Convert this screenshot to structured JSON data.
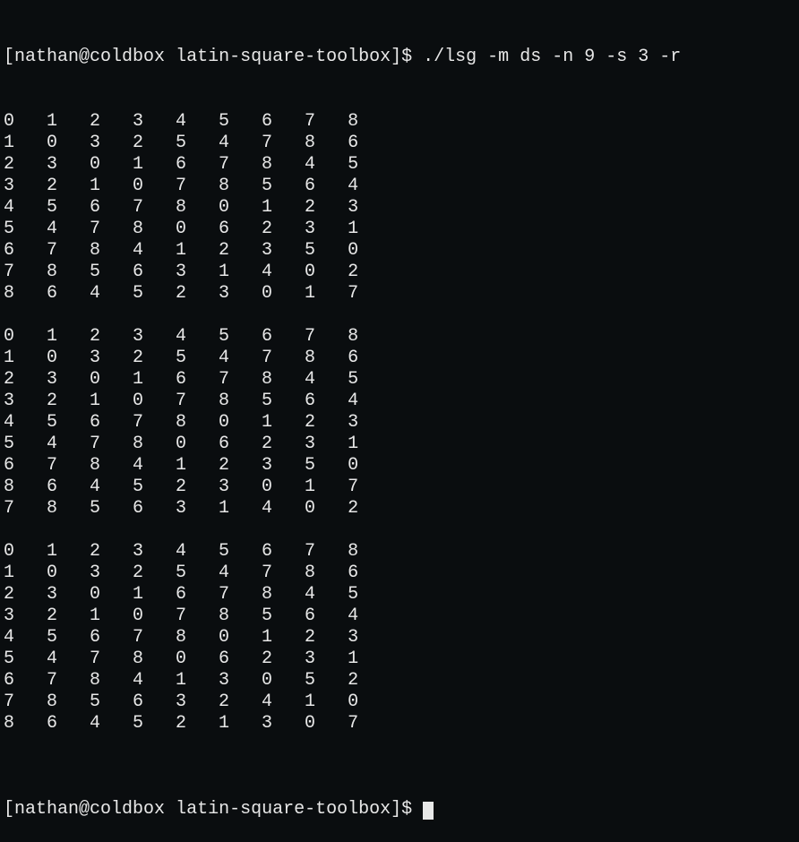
{
  "prompt1": {
    "user": "nathan",
    "host": "coldbox",
    "dir": "latin-square-toolbox",
    "symbol": "$",
    "command": "./lsg -m ds -n 9 -s 3 -r"
  },
  "prompt2": {
    "user": "nathan",
    "host": "coldbox",
    "dir": "latin-square-toolbox",
    "symbol": "$"
  },
  "squares": [
    [
      [
        0,
        1,
        2,
        3,
        4,
        5,
        6,
        7,
        8
      ],
      [
        1,
        0,
        3,
        2,
        5,
        4,
        7,
        8,
        6
      ],
      [
        2,
        3,
        0,
        1,
        6,
        7,
        8,
        4,
        5
      ],
      [
        3,
        2,
        1,
        0,
        7,
        8,
        5,
        6,
        4
      ],
      [
        4,
        5,
        6,
        7,
        8,
        0,
        1,
        2,
        3
      ],
      [
        5,
        4,
        7,
        8,
        0,
        6,
        2,
        3,
        1
      ],
      [
        6,
        7,
        8,
        4,
        1,
        2,
        3,
        5,
        0
      ],
      [
        7,
        8,
        5,
        6,
        3,
        1,
        4,
        0,
        2
      ],
      [
        8,
        6,
        4,
        5,
        2,
        3,
        0,
        1,
        7
      ]
    ],
    [
      [
        0,
        1,
        2,
        3,
        4,
        5,
        6,
        7,
        8
      ],
      [
        1,
        0,
        3,
        2,
        5,
        4,
        7,
        8,
        6
      ],
      [
        2,
        3,
        0,
        1,
        6,
        7,
        8,
        4,
        5
      ],
      [
        3,
        2,
        1,
        0,
        7,
        8,
        5,
        6,
        4
      ],
      [
        4,
        5,
        6,
        7,
        8,
        0,
        1,
        2,
        3
      ],
      [
        5,
        4,
        7,
        8,
        0,
        6,
        2,
        3,
        1
      ],
      [
        6,
        7,
        8,
        4,
        1,
        2,
        3,
        5,
        0
      ],
      [
        8,
        6,
        4,
        5,
        2,
        3,
        0,
        1,
        7
      ],
      [
        7,
        8,
        5,
        6,
        3,
        1,
        4,
        0,
        2
      ]
    ],
    [
      [
        0,
        1,
        2,
        3,
        4,
        5,
        6,
        7,
        8
      ],
      [
        1,
        0,
        3,
        2,
        5,
        4,
        7,
        8,
        6
      ],
      [
        2,
        3,
        0,
        1,
        6,
        7,
        8,
        4,
        5
      ],
      [
        3,
        2,
        1,
        0,
        7,
        8,
        5,
        6,
        4
      ],
      [
        4,
        5,
        6,
        7,
        8,
        0,
        1,
        2,
        3
      ],
      [
        5,
        4,
        7,
        8,
        0,
        6,
        2,
        3,
        1
      ],
      [
        6,
        7,
        8,
        4,
        1,
        3,
        0,
        5,
        2
      ],
      [
        7,
        8,
        5,
        6,
        3,
        2,
        4,
        1,
        0
      ],
      [
        8,
        6,
        4,
        5,
        2,
        1,
        3,
        0,
        7
      ]
    ]
  ]
}
